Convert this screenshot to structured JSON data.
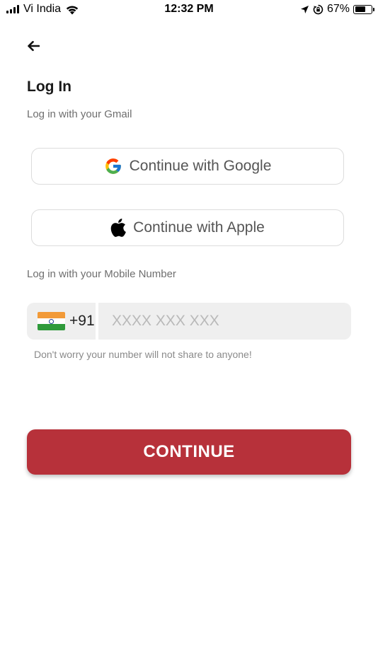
{
  "status_bar": {
    "carrier": "Vi India",
    "time": "12:32 PM",
    "battery_percent": "67%",
    "battery_level": 0.67
  },
  "header": {
    "back_icon": "arrow-left-icon",
    "title": "Log In"
  },
  "gmail_section": {
    "label": "Log in with your Gmail",
    "google_button_label": "Continue with Google",
    "google_icon": "google-icon",
    "apple_button_label": "Continue with Apple",
    "apple_icon": "apple-icon"
  },
  "mobile_section": {
    "label": "Log in with your Mobile Number",
    "country_flag": "india-flag-icon",
    "country_code": "+91",
    "phone_placeholder": "XXXX XXX XXX",
    "phone_value": "",
    "helper_text": "Don't worry your number will not share to anyone!"
  },
  "continue_button_label": "CONTINUE",
  "colors": {
    "accent": "#b7313a",
    "input_background": "#efefef",
    "button_border": "#dcdcdc"
  }
}
